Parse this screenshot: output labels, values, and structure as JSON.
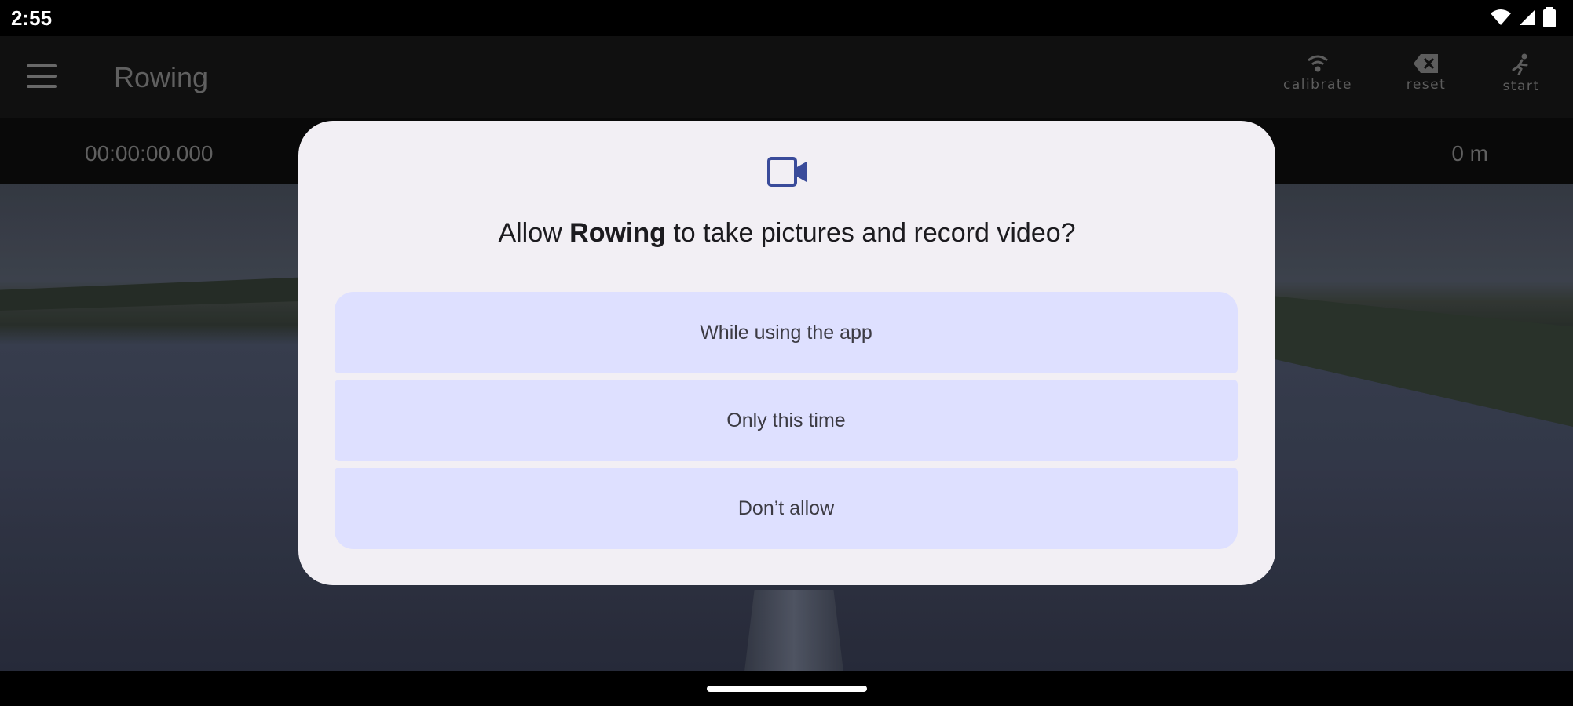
{
  "status_bar": {
    "time": "2:55",
    "icons": [
      "wifi-icon",
      "signal-icon",
      "battery-icon"
    ]
  },
  "app_bar": {
    "title": "Rowing",
    "actions": [
      {
        "label": "calibrate",
        "icon": "calibrate-icon"
      },
      {
        "label": "reset",
        "icon": "backspace-icon"
      },
      {
        "label": "start",
        "icon": "runner-icon"
      }
    ]
  },
  "info_bar": {
    "elapsed": "00:00:00.000",
    "distance": "0 m"
  },
  "dialog": {
    "icon": "videocam-icon",
    "title_prefix": "Allow ",
    "app_name": "Rowing",
    "title_suffix": " to take pictures and record video?",
    "options": [
      "While using the app",
      "Only this time",
      "Don’t allow"
    ]
  },
  "colors": {
    "dialog_bg": "#f2eff4",
    "option_bg": "#dee0ff",
    "icon_accent": "#3a4b9a"
  }
}
